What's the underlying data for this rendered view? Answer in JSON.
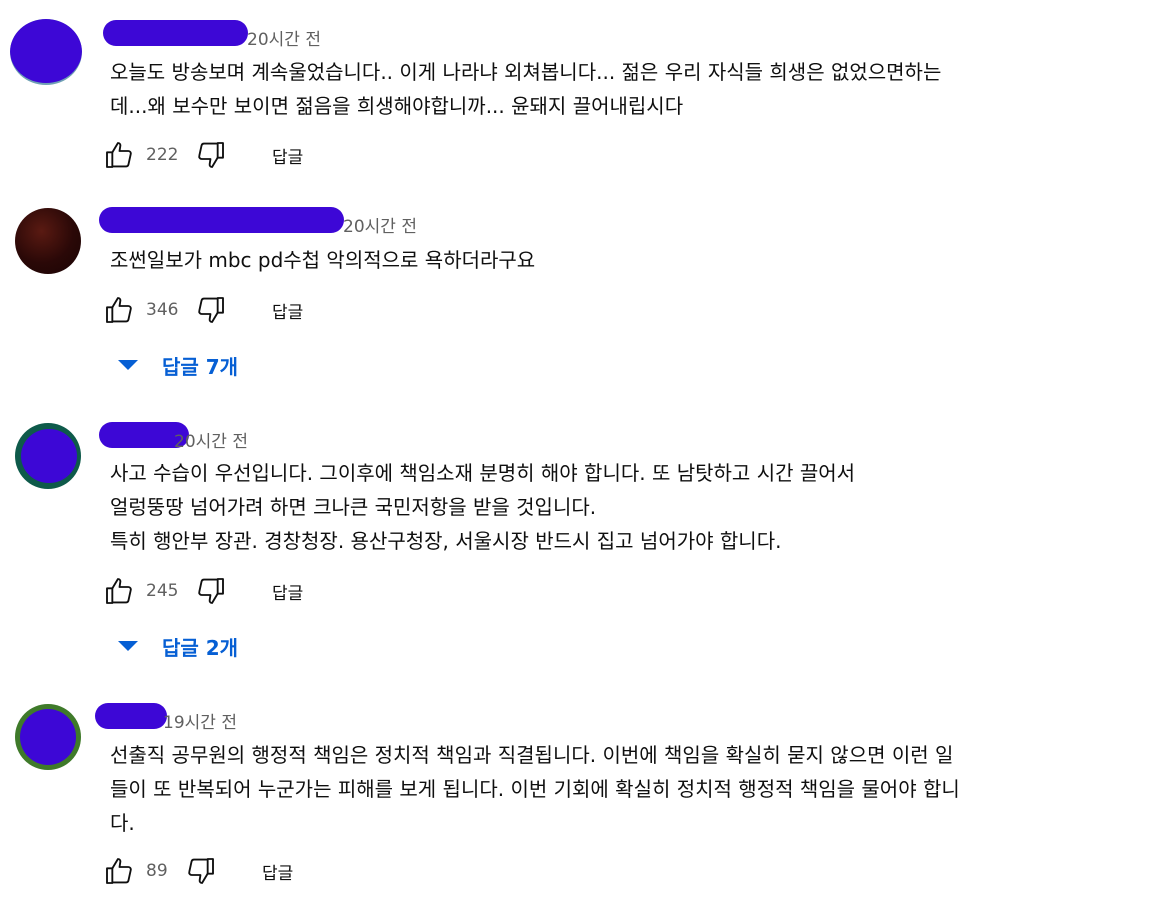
{
  "colors": {
    "redaction": "#3d07d6",
    "link_blue": "#065fd4",
    "meta_gray": "#606060"
  },
  "comments": [
    {
      "timestamp": "20시간 전",
      "lines": [
        "오늘도 방송보며 계속울었습니다.. 이게 나라냐 외쳐봅니다... 젊은 우리 자식들 희생은 없었으면하는",
        "데...왜 보수만 보이면 젊음을 희생해야합니까... 윤돼지 끌어내립시다"
      ],
      "likes": "222",
      "reply_label": "답글"
    },
    {
      "timestamp": "20시간 전",
      "lines": [
        "조썬일보가 mbc pd수첩 악의적으로 욕하더라구요"
      ],
      "likes": "346",
      "reply_label": "답글",
      "replies_toggle": "답글 7개"
    },
    {
      "timestamp": "20시간 전",
      "lines": [
        "사고 수습이 우선입니다. 그이후에 책임소재 분명히 해야 합니다. 또 남탓하고 시간  끌어서",
        "얼렁뚱땅 넘어가려 하면 크나큰 국민저항을 받을 것입니다.",
        "특히 행안부 장관. 경창청장. 용산구청장, 서울시장  반드시 집고 넘어가야 합니다."
      ],
      "likes": "245",
      "reply_label": "답글",
      "replies_toggle": "답글 2개"
    },
    {
      "timestamp": "19시간 전",
      "lines": [
        "선출직 공무원의 행정적 책임은 정치적 책임과 직결됩니다. 이번에 책임을 확실히 묻지 않으면 이런 일",
        "들이 또 반복되어 누군가는 피해를 보게 됩니다. 이번 기회에 확실히 정치적 행정적 책임을 물어야 합니",
        "다."
      ],
      "likes": "89",
      "reply_label": "답글"
    }
  ]
}
